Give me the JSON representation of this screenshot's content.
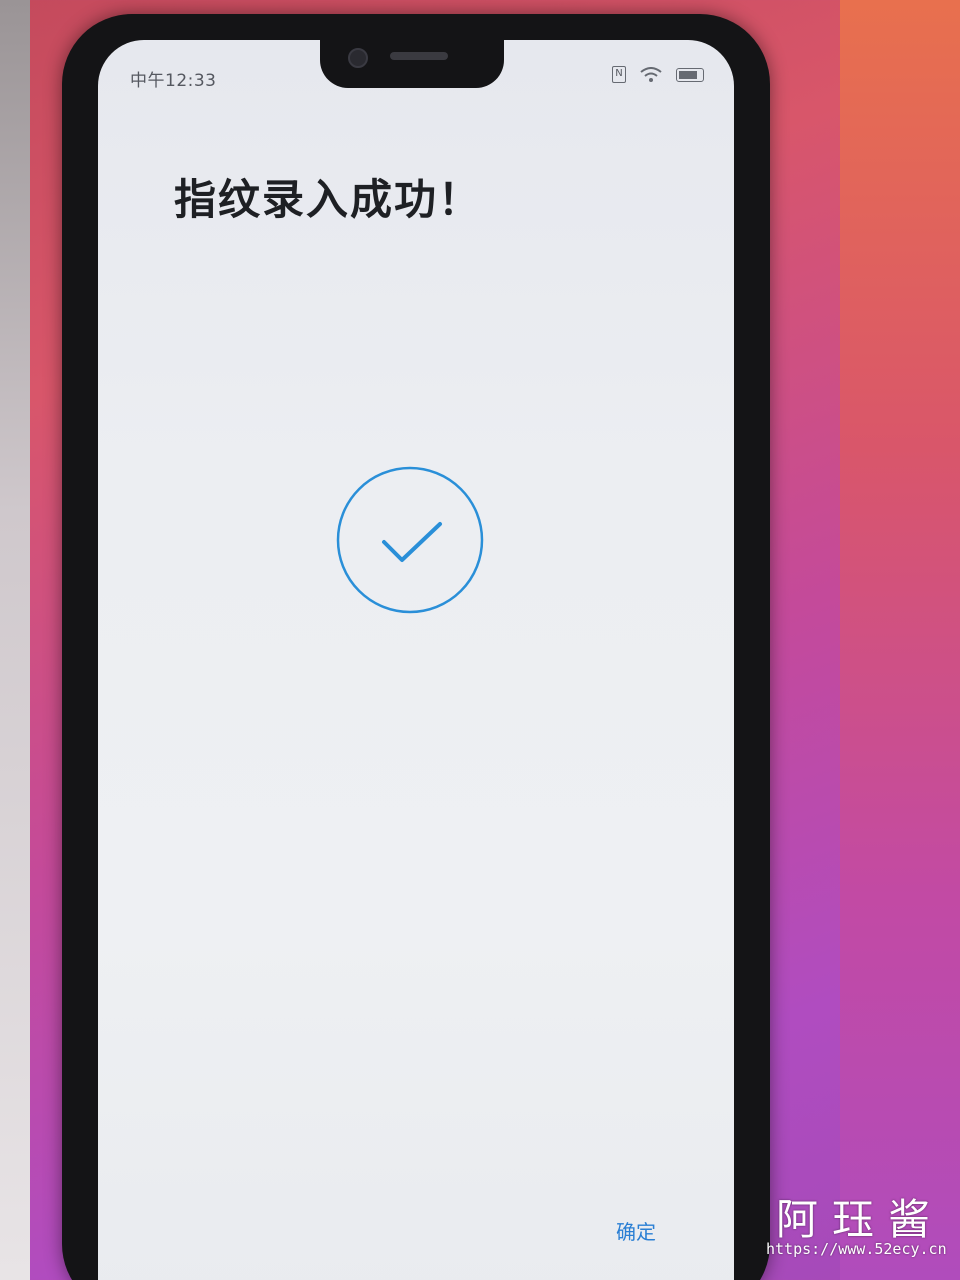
{
  "status_bar": {
    "time": "中午12:33"
  },
  "page": {
    "title": "指纹录入成功！"
  },
  "success": {
    "icon": "check-circle-icon",
    "accent_color": "#2a8fd8"
  },
  "footer": {
    "confirm_label": "确定"
  },
  "watermark": {
    "name": "阿珏酱",
    "url": "https://www.52ecy.cn"
  }
}
